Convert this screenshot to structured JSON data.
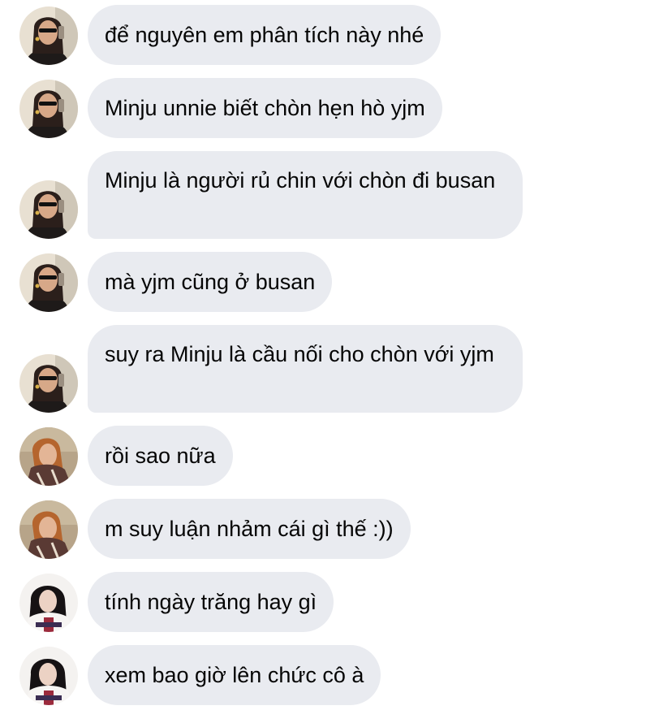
{
  "messages": [
    {
      "text": "để nguyên em phân tích này nhé",
      "avatar": "user-a-avatar"
    },
    {
      "text": "Minju unnie biết chòn hẹn hò yjm",
      "avatar": "user-a-avatar"
    },
    {
      "text": " Minju là người rủ chin với chòn đi busan",
      "avatar": "user-a-avatar"
    },
    {
      "text": "mà yjm cũng ở busan",
      "avatar": "user-a-avatar"
    },
    {
      "text": "suy ra Minju là cầu nối cho chòn với yjm",
      "avatar": "user-a-avatar"
    },
    {
      "text": "rồi sao nữa",
      "avatar": "user-b-avatar"
    },
    {
      "text": "m suy luận nhảm cái gì thế :))",
      "avatar": "user-b-avatar"
    },
    {
      "text": "tính ngày trăng hay gì",
      "avatar": "user-c-avatar"
    },
    {
      "text": "xem bao giờ lên chức cô à",
      "avatar": "user-c-avatar"
    }
  ],
  "colors": {
    "bubble_bg": "#e9ebf0",
    "text": "#050505",
    "background": "#ffffff"
  }
}
